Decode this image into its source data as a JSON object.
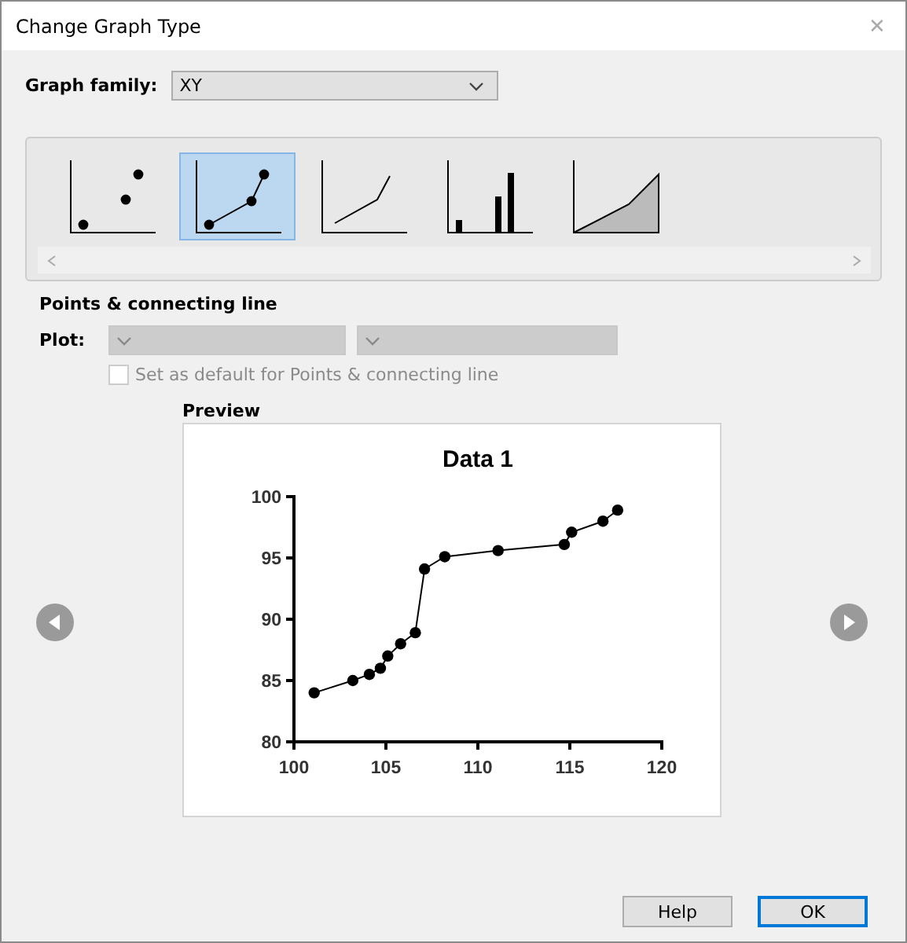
{
  "window": {
    "title": "Change Graph Type",
    "close": "✕"
  },
  "graph_family": {
    "label": "Graph family:",
    "value": "XY"
  },
  "gallery": [
    {
      "kind": "scatter",
      "selected": false
    },
    {
      "kind": "points-line",
      "selected": true
    },
    {
      "kind": "line",
      "selected": false
    },
    {
      "kind": "bars",
      "selected": false
    },
    {
      "kind": "area",
      "selected": false
    }
  ],
  "section_title": "Points & connecting line",
  "plot": {
    "label": "Plot:",
    "disabled": true
  },
  "default_checkbox": {
    "label": "Set as default for Points & connecting line",
    "checked": false,
    "disabled": true
  },
  "preview": {
    "label": "Preview",
    "chart_data": {
      "type": "line",
      "x": [
        101.1,
        103.2,
        104.1,
        104.7,
        105.1,
        105.8,
        106.6,
        107.1,
        108.2,
        111.1,
        114.7,
        115.1,
        116.8,
        117.6
      ],
      "series": [
        {
          "name": "Data 1",
          "color": "#000000",
          "marker": "circle",
          "values": [
            84.0,
            85.0,
            85.5,
            86.0,
            87.0,
            88.0,
            88.9,
            94.1,
            95.1,
            95.6,
            96.1,
            97.1,
            98.0,
            98.9
          ]
        }
      ],
      "xlim": [
        100,
        120
      ],
      "ylim": [
        80,
        100
      ],
      "xticks": [
        100,
        105,
        110,
        115,
        120
      ],
      "yticks": [
        80,
        85,
        90,
        95,
        100
      ]
    }
  },
  "buttons": [
    {
      "label": "Help",
      "default": false
    },
    {
      "label": "OK",
      "default": true
    }
  ]
}
